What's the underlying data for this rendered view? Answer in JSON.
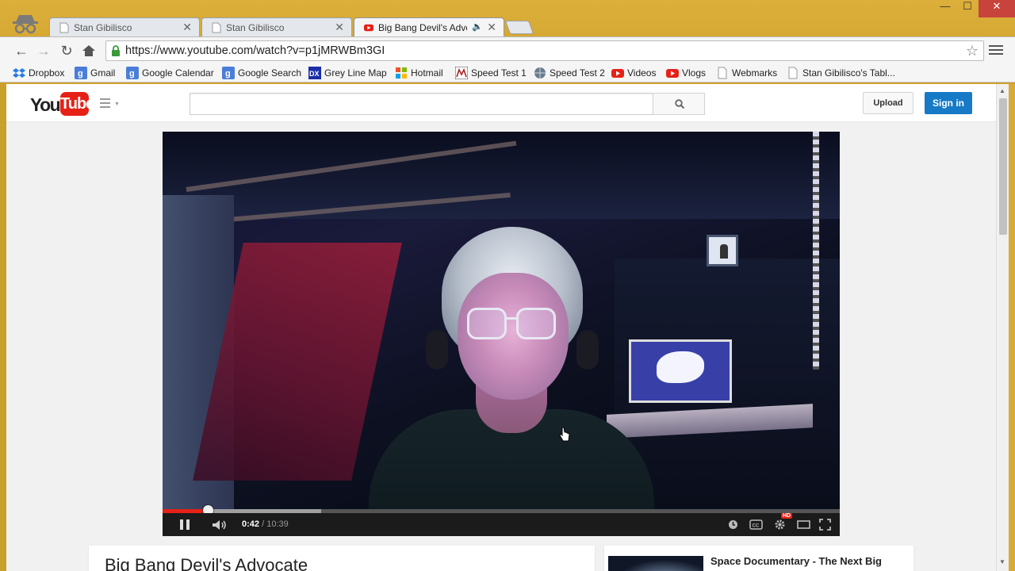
{
  "browser": {
    "tabs": [
      {
        "label": "Stan Gibilisco"
      },
      {
        "label": "Stan Gibilisco"
      },
      {
        "label": "Big Bang Devil's Advoc"
      }
    ],
    "window_controls": {
      "minimize": "—",
      "maximize": "☐",
      "close": "✕"
    },
    "url": "https://www.youtube.com/watch?v=p1jMRWBm3GI",
    "bookmarks": [
      {
        "label": "Dropbox",
        "icon": "dropbox-icon"
      },
      {
        "label": "Gmail",
        "icon": "google-icon"
      },
      {
        "label": "Google Calendar",
        "icon": "google-icon"
      },
      {
        "label": "Google Search",
        "icon": "google-icon"
      },
      {
        "label": "Grey Line Map",
        "icon": "dx-icon"
      },
      {
        "label": "Hotmail",
        "icon": "windows-icon"
      },
      {
        "label": "Speed Test 1",
        "icon": "speedtest-icon"
      },
      {
        "label": "Speed Test 2",
        "icon": "globe-icon"
      },
      {
        "label": "Videos",
        "icon": "youtube-icon"
      },
      {
        "label": "Vlogs",
        "icon": "youtube-icon"
      },
      {
        "label": "Webmarks",
        "icon": "page-icon"
      },
      {
        "label": "Stan Gibilisco's Tabl...",
        "icon": "page-icon"
      }
    ]
  },
  "youtube": {
    "logo_you": "You",
    "logo_tube": "Tube",
    "search_placeholder": "",
    "upload_label": "Upload",
    "signin_label": "Sign in",
    "brand_red": "#e62117",
    "brand_blue": "#167ac6"
  },
  "player": {
    "current_time": "0:42",
    "separator": "/",
    "duration": "10:39",
    "played_fraction": 0.067,
    "buffered_fraction": 0.234,
    "hd_badge": "HD"
  },
  "video": {
    "title": "Big Bang Devil's Advocate"
  },
  "related": {
    "first_title": "Space Documentary - The Next Big"
  }
}
